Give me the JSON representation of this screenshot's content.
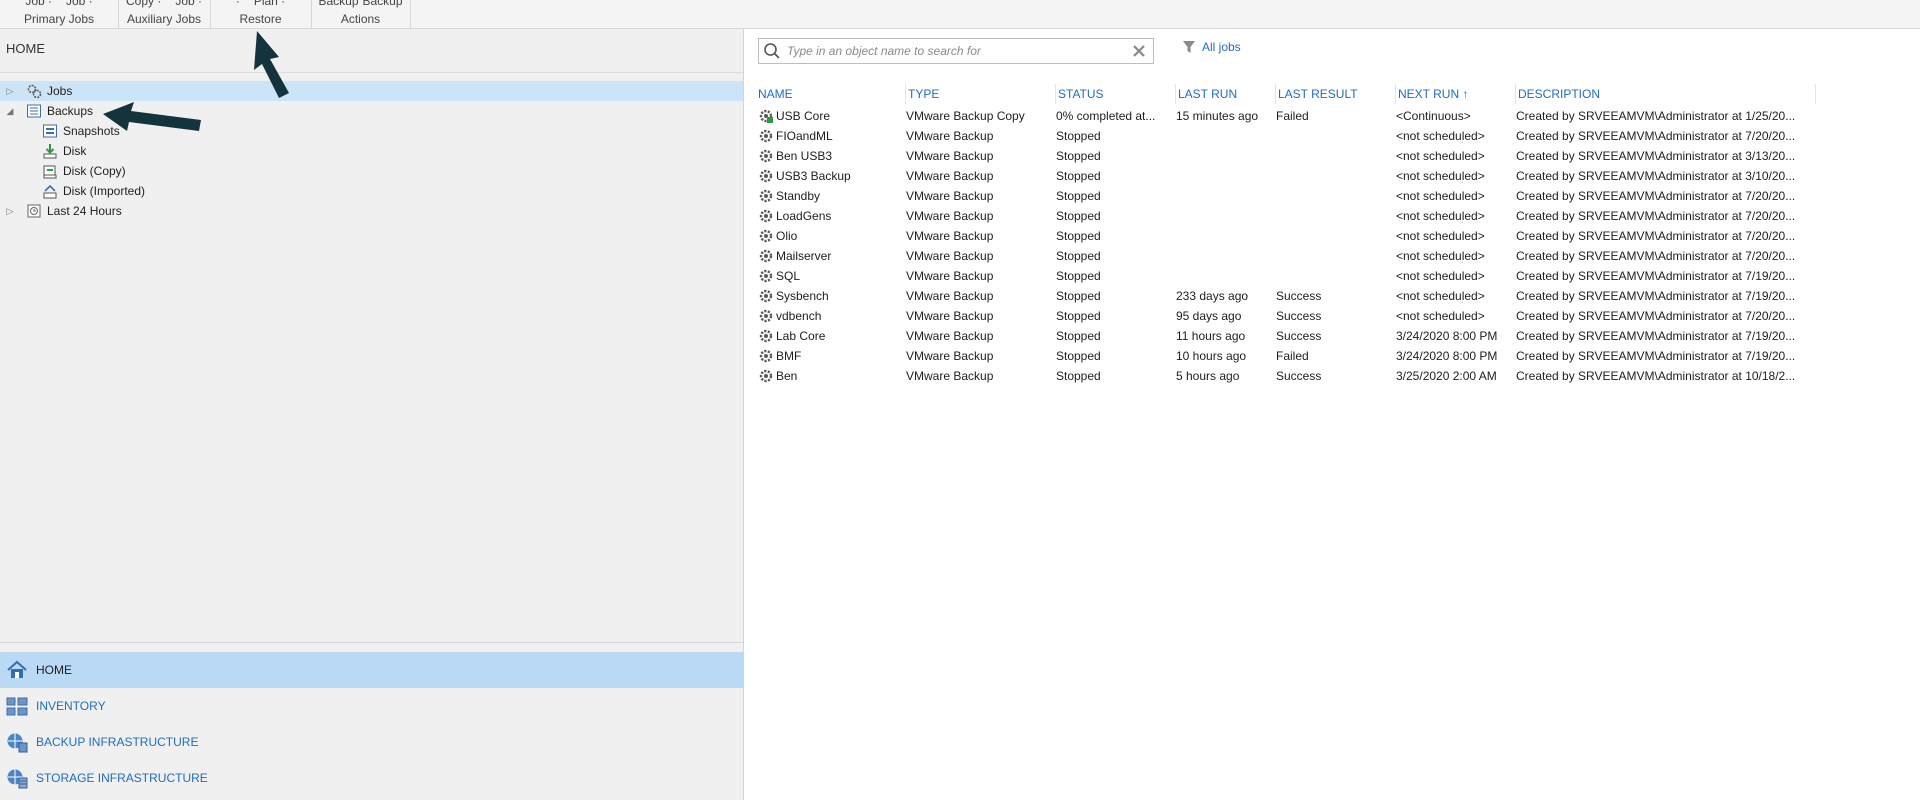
{
  "ribbon": {
    "groups": [
      {
        "cut_items": [
          "Job ·",
          "Job ·"
        ],
        "label": "Primary Jobs"
      },
      {
        "cut_items": [
          "Copy ·",
          "Job ·"
        ],
        "label": "Auxiliary Jobs"
      },
      {
        "cut_items": [
          "·",
          "Plan ·"
        ],
        "label": "Restore"
      },
      {
        "cut_items": [
          "Backup",
          "Backup"
        ],
        "label": "Actions"
      }
    ]
  },
  "left": {
    "header": "HOME",
    "tree": [
      {
        "label": "Jobs",
        "icon": "gear-jobs-icon",
        "expander": "▷"
      },
      {
        "label": "Backups",
        "icon": "backups-icon",
        "expander": "◢"
      },
      {
        "label": "Snapshots",
        "icon": "snapshots-icon"
      },
      {
        "label": "Disk",
        "icon": "disk-icon"
      },
      {
        "label": "Disk (Copy)",
        "icon": "disk-copy-icon"
      },
      {
        "label": "Disk (Imported)",
        "icon": "disk-imported-icon"
      },
      {
        "label": "Last 24 Hours",
        "icon": "last-24-hours-icon",
        "expander": "▷"
      }
    ],
    "nav": [
      {
        "label": "HOME",
        "icon": "home-icon",
        "active": true
      },
      {
        "label": "INVENTORY",
        "icon": "inventory-icon"
      },
      {
        "label": "BACKUP INFRASTRUCTURE",
        "icon": "backup-infrastructure-icon"
      },
      {
        "label": "STORAGE INFRASTRUCTURE",
        "icon": "storage-infrastructure-icon"
      }
    ]
  },
  "search": {
    "placeholder": "Type in an object name to search for"
  },
  "filter": {
    "label": "All jobs"
  },
  "table": {
    "columns": [
      {
        "key": "name",
        "label": "NAME"
      },
      {
        "key": "type",
        "label": "TYPE"
      },
      {
        "key": "status",
        "label": "STATUS"
      },
      {
        "key": "last_run",
        "label": "LAST RUN"
      },
      {
        "key": "last_result",
        "label": "LAST RESULT"
      },
      {
        "key": "next_run",
        "label": "NEXT RUN",
        "sort": "↑"
      },
      {
        "key": "description",
        "label": "DESCRIPTION"
      }
    ],
    "rows": [
      {
        "name": "USB Core",
        "type": "VMware Backup Copy",
        "status": "0% completed at...",
        "last_run": "15 minutes ago",
        "last_result": "Failed",
        "next_run": "<Continuous>",
        "description": "Created by SRVEEAMVM\\Administrator at 1/25/20..."
      },
      {
        "name": "FIOandML",
        "type": "VMware Backup",
        "status": "Stopped",
        "last_run": "",
        "last_result": "",
        "next_run": "<not scheduled>",
        "description": "Created by SRVEEAMVM\\Administrator at 7/20/20..."
      },
      {
        "name": "Ben USB3",
        "type": "VMware Backup",
        "status": "Stopped",
        "last_run": "",
        "last_result": "",
        "next_run": "<not scheduled>",
        "description": "Created by SRVEEAMVM\\Administrator at 3/13/20..."
      },
      {
        "name": "USB3 Backup",
        "type": "VMware Backup",
        "status": "Stopped",
        "last_run": "",
        "last_result": "",
        "next_run": "<not scheduled>",
        "description": "Created by SRVEEAMVM\\Administrator at 3/10/20..."
      },
      {
        "name": "Standby",
        "type": "VMware Backup",
        "status": "Stopped",
        "last_run": "",
        "last_result": "",
        "next_run": "<not scheduled>",
        "description": "Created by SRVEEAMVM\\Administrator at 7/20/20..."
      },
      {
        "name": "LoadGens",
        "type": "VMware Backup",
        "status": "Stopped",
        "last_run": "",
        "last_result": "",
        "next_run": "<not scheduled>",
        "description": "Created by SRVEEAMVM\\Administrator at 7/20/20..."
      },
      {
        "name": "Olio",
        "type": "VMware Backup",
        "status": "Stopped",
        "last_run": "",
        "last_result": "",
        "next_run": "<not scheduled>",
        "description": "Created by SRVEEAMVM\\Administrator at 7/20/20..."
      },
      {
        "name": "Mailserver",
        "type": "VMware Backup",
        "status": "Stopped",
        "last_run": "",
        "last_result": "",
        "next_run": "<not scheduled>",
        "description": "Created by SRVEEAMVM\\Administrator at 7/20/20..."
      },
      {
        "name": "SQL",
        "type": "VMware Backup",
        "status": "Stopped",
        "last_run": "",
        "last_result": "",
        "next_run": "<not scheduled>",
        "description": "Created by SRVEEAMVM\\Administrator at 7/19/20..."
      },
      {
        "name": "Sysbench",
        "type": "VMware Backup",
        "status": "Stopped",
        "last_run": "233 days ago",
        "last_result": "Success",
        "next_run": "<not scheduled>",
        "description": "Created by SRVEEAMVM\\Administrator at 7/19/20..."
      },
      {
        "name": "vdbench",
        "type": "VMware Backup",
        "status": "Stopped",
        "last_run": "95 days ago",
        "last_result": "Success",
        "next_run": "<not scheduled>",
        "description": "Created by SRVEEAMVM\\Administrator at 7/20/20..."
      },
      {
        "name": "Lab Core",
        "type": "VMware Backup",
        "status": "Stopped",
        "last_run": "11 hours ago",
        "last_result": "Success",
        "next_run": "3/24/2020 8:00 PM",
        "description": "Created by SRVEEAMVM\\Administrator at 7/19/20..."
      },
      {
        "name": "BMF",
        "type": "VMware Backup",
        "status": "Stopped",
        "last_run": "10 hours ago",
        "last_result": "Failed",
        "next_run": "3/24/2020 8:00 PM",
        "description": "Created by SRVEEAMVM\\Administrator at 7/19/20..."
      },
      {
        "name": "Ben",
        "type": "VMware Backup",
        "status": "Stopped",
        "last_run": "5 hours ago",
        "last_result": "Success",
        "next_run": "3/25/2020 2:00 AM",
        "description": "Created by SRVEEAMVM\\Administrator at 10/18/2..."
      }
    ]
  },
  "colors": {
    "accent": "#1f6dbf",
    "selection": "#cce4f7",
    "nav_active": "#b9d9f5",
    "arrow": "#14343d"
  }
}
